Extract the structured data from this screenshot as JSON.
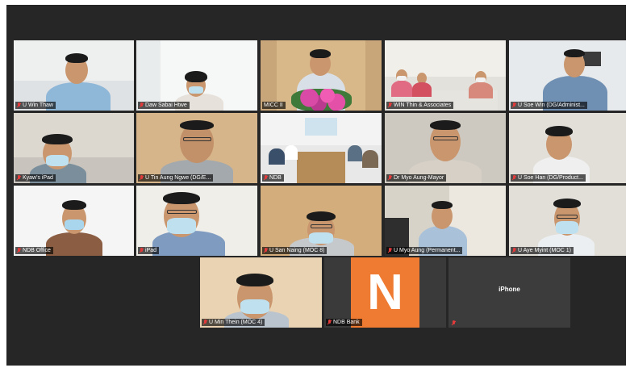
{
  "meeting": {
    "participants": [
      {
        "name": "U Win Thaw",
        "muted": true
      },
      {
        "name": "Daw Sabai Htwe",
        "muted": true
      },
      {
        "name": "MICC II",
        "muted": false
      },
      {
        "name": "WIN Thin & Associates",
        "muted": true
      },
      {
        "name": "U Soe Win (DG/Administ...",
        "muted": true
      },
      {
        "name": "Kyaw's iPad",
        "muted": true
      },
      {
        "name": "U Tin Aung Ngwe (DG/E...",
        "muted": true
      },
      {
        "name": "NDB",
        "muted": true
      },
      {
        "name": "Dr Myo Aung-Mayor",
        "muted": true
      },
      {
        "name": "U Soe Han (DG/Product...",
        "muted": true
      },
      {
        "name": "NDB Office",
        "muted": true
      },
      {
        "name": "iPad",
        "muted": true
      },
      {
        "name": "U San Naing (MOC 8)",
        "muted": true
      },
      {
        "name": "U Myo Aung (Permanent...",
        "muted": true
      },
      {
        "name": "U Aye Myint (MOC 1)",
        "muted": true
      },
      {
        "name": "U Min Thein (MOC 4)",
        "muted": true
      },
      {
        "name": "NDB Bank",
        "muted": true
      },
      {
        "name": "iPhone",
        "muted": true
      }
    ],
    "ndb_logo_letter": "N",
    "iphone_label": "iPhone"
  },
  "colors": {
    "background": "#262626",
    "ndb_orange": "#ef7a31",
    "muted_icon": "#e23b3b"
  }
}
